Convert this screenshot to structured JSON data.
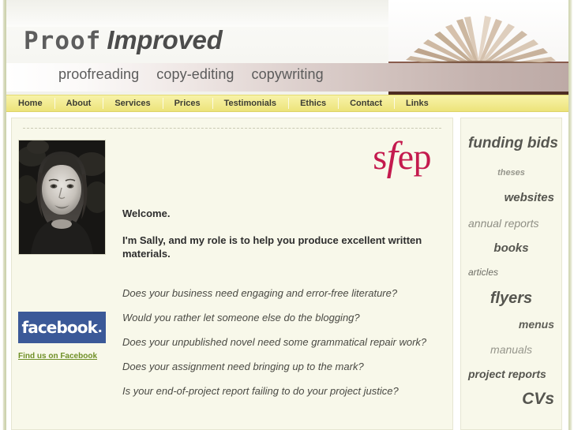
{
  "header": {
    "logo_primary": "Proof",
    "logo_secondary": "Improved",
    "tagline": [
      "proofreading",
      "copy-editing",
      "copywriting"
    ],
    "book_image_alt": "open-book-photo"
  },
  "nav": {
    "items": [
      {
        "label": "Home"
      },
      {
        "label": "About"
      },
      {
        "label": "Services"
      },
      {
        "label": "Prices"
      },
      {
        "label": "Testimonials"
      },
      {
        "label": "Ethics"
      },
      {
        "label": "Contact"
      },
      {
        "label": "Links"
      }
    ]
  },
  "main": {
    "portrait_alt": "portrait-photo-of-sally",
    "sfep": {
      "part1": "s",
      "part2": "f",
      "part3": "ep"
    },
    "welcome_heading": "Welcome.",
    "welcome_intro": "I'm Sally, and my role is to help you produce excellent written materials.",
    "questions": [
      "Does your business need engaging and error-free literature?",
      "Would you rather let someone else do the blogging?",
      "Does your unpublished novel need some grammatical repair work?",
      "Does your assignment need bringing up to the mark?",
      "Is your end-of-project report failing to do your project justice?"
    ],
    "facebook": {
      "badge_label": "facebook",
      "badge_dot": ".",
      "link_label": "Find us on Facebook",
      "badge_color": "#3b5998",
      "link_color": "#6f8f26"
    }
  },
  "sidebar": {
    "items": [
      {
        "label": "funding bids",
        "size": 19,
        "weight": 700,
        "align": "left",
        "color": "#575751"
      },
      {
        "label": "theses",
        "size": 11,
        "weight": 700,
        "align": "center",
        "color": "#96968c"
      },
      {
        "label": "websites",
        "size": 15,
        "weight": 700,
        "align": "right",
        "color": "#55554f"
      },
      {
        "label": "annual reports",
        "size": 14,
        "weight": 400,
        "align": "left",
        "color": "#8e8e84"
      },
      {
        "label": "books",
        "size": 15,
        "weight": 700,
        "align": "center",
        "color": "#55554f"
      },
      {
        "label": "articles",
        "size": 12,
        "weight": 400,
        "align": "left",
        "color": "#6e6e66"
      },
      {
        "label": "flyers",
        "size": 20,
        "weight": 700,
        "align": "center",
        "color": "#55554f"
      },
      {
        "label": "menus",
        "size": 14,
        "weight": 700,
        "align": "right",
        "color": "#5e5e57"
      },
      {
        "label": "manuals",
        "size": 14,
        "weight": 400,
        "align": "center",
        "color": "#96968c"
      },
      {
        "label": "project reports",
        "size": 14,
        "weight": 700,
        "align": "left",
        "color": "#55554f"
      },
      {
        "label": "CVs",
        "size": 21,
        "weight": 700,
        "align": "right",
        "color": "#55554f"
      }
    ],
    "spacings": [
      22,
      18,
      17,
      16,
      16,
      17,
      15,
      17,
      16,
      14,
      0
    ]
  },
  "theme": {
    "panel_bg": "#f8f8ea",
    "nav_yellow": "#f3ec95",
    "accent_crimson": "#c41a4e"
  }
}
